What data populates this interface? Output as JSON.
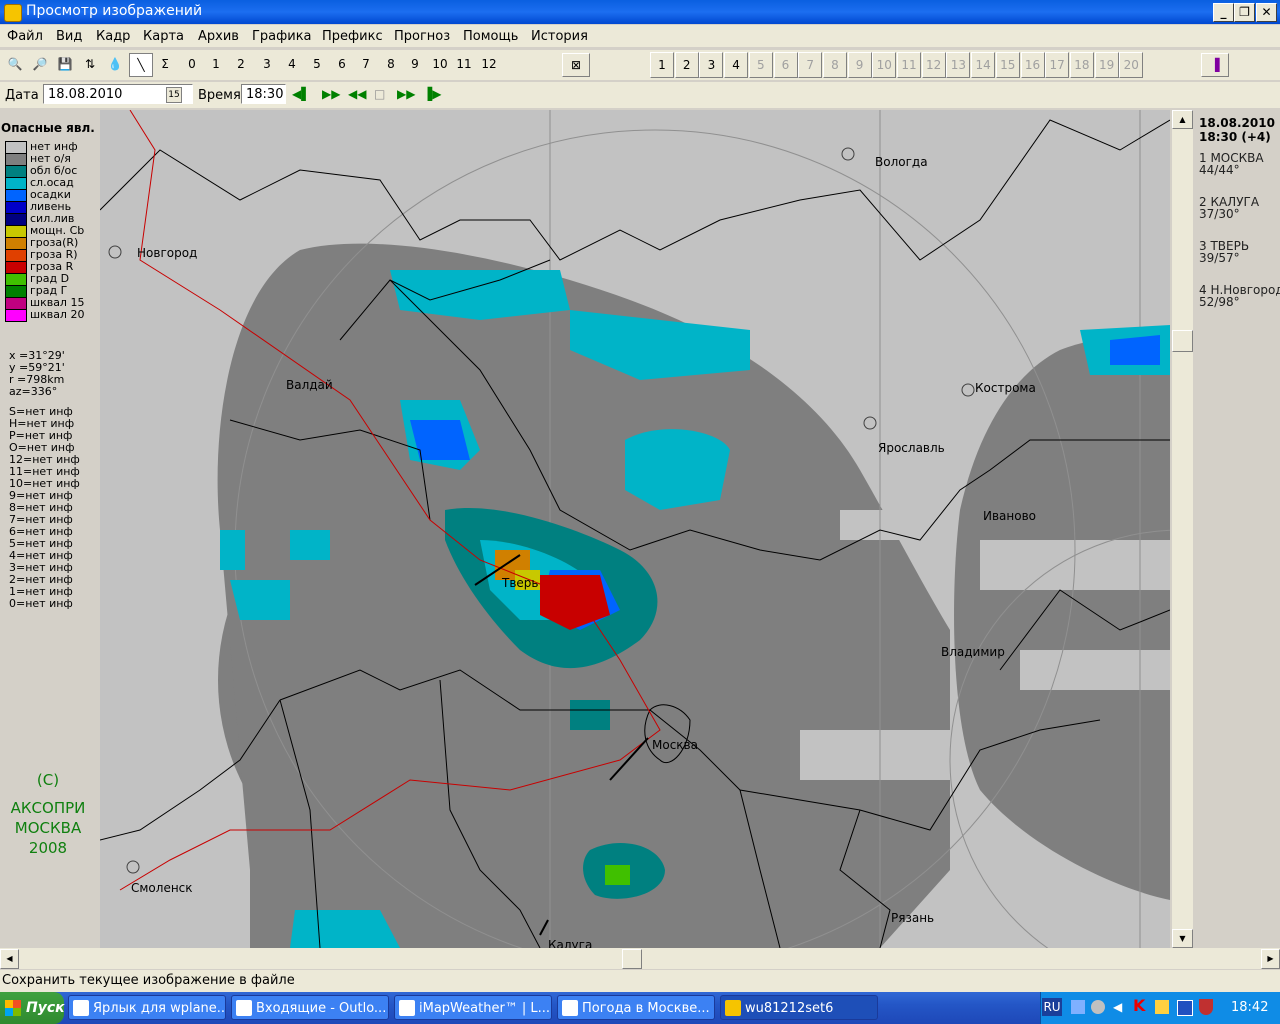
{
  "window": {
    "title": "Просмотр изображений"
  },
  "menu": [
    "Файл",
    "Вид",
    "Кадр",
    "Карта",
    "Архив",
    "Графика",
    "Префикс",
    "Прогноз",
    "Помощь",
    "История"
  ],
  "toolbar": {
    "hour_buttons": [
      "0",
      "1",
      "2",
      "3",
      "4",
      "5",
      "6",
      "7",
      "8",
      "9",
      "10",
      "11",
      "12"
    ],
    "frame_buttons": [
      "1",
      "2",
      "3",
      "4",
      "5",
      "6",
      "7",
      "8",
      "9",
      "10",
      "11",
      "12",
      "13",
      "14",
      "15",
      "16",
      "17",
      "18",
      "19",
      "20"
    ],
    "frame_enabled_count": 4
  },
  "datebar": {
    "date_label": "Дата",
    "date_value": "18.08.2010",
    "time_label": "Время",
    "time_value": "18:30"
  },
  "legend": {
    "title": "Опасные явл.",
    "items": [
      {
        "label": "нет инф",
        "color": "#c2c2c2"
      },
      {
        "label": "нет о/я",
        "color": "#7f7f7f"
      },
      {
        "label": "обл б/ос",
        "color": "#008080"
      },
      {
        "label": "сл.осад",
        "color": "#00b4c8"
      },
      {
        "label": "осадки",
        "color": "#0064ff"
      },
      {
        "label": "ливень",
        "color": "#0000c8"
      },
      {
        "label": "сил.лив",
        "color": "#000080"
      },
      {
        "label": "мощн. Cb",
        "color": "#c8c800"
      },
      {
        "label": "гроза(R)",
        "color": "#d08000"
      },
      {
        "label": "гроза R)",
        "color": "#e04000"
      },
      {
        "label": "гроза R",
        "color": "#c80000"
      },
      {
        "label": "град  D",
        "color": "#40c000"
      },
      {
        "label": "град  Г",
        "color": "#008000"
      },
      {
        "label": "шквал 15",
        "color": "#c00080"
      },
      {
        "label": "шквал 20",
        "color": "#ff00ff"
      }
    ]
  },
  "coords": [
    "x =31°29'",
    "y =59°21'",
    "r =798km",
    "az=336°"
  ],
  "heights": [
    "S=нет инф",
    "H=нет инф",
    "P=нет инф",
    "O=нет инф",
    "12=нет инф",
    "11=нет инф",
    "10=нет инф",
    "9=нет инф",
    "8=нет инф",
    "7=нет инф",
    "6=нет инф",
    "5=нет инф",
    "4=нет инф",
    "3=нет инф",
    "2=нет инф",
    "1=нет инф",
    "0=нет инф"
  ],
  "copyright": [
    "(C)",
    "АКСОПРИ",
    "МОСКВА",
    "2008"
  ],
  "map": {
    "cities": [
      {
        "name": "Вологда"
      },
      {
        "name": "Новгород"
      },
      {
        "name": "Валдай"
      },
      {
        "name": "Кострома"
      },
      {
        "name": "Ярославль"
      },
      {
        "name": "Иваново"
      },
      {
        "name": "Тверь"
      },
      {
        "name": "Владимир"
      },
      {
        "name": "Москва"
      },
      {
        "name": "Смоленск"
      },
      {
        "name": "Рязань"
      },
      {
        "name": "Калуга"
      }
    ]
  },
  "rightpanel": {
    "date": "18.08.2010",
    "time": "18:30 (+4)",
    "stations": [
      {
        "name": "1 МОСКВА",
        "value": "44/44°"
      },
      {
        "name": "2 КАЛУГА",
        "value": "37/30°"
      },
      {
        "name": "3 ТВЕРЬ",
        "value": "39/57°"
      },
      {
        "name": "4 Н.Новгород",
        "value": "52/98°"
      }
    ]
  },
  "status": "Сохранить текущее изображение в файле",
  "taskbar": {
    "start": "Пуск",
    "tasks": [
      "Ярлык для wplane...",
      "Входящие - Outlo...",
      "iMapWeather™ | L...",
      "Погода в Москве...",
      "wu81212set6"
    ],
    "lang": "RU",
    "clock": "18:42"
  }
}
